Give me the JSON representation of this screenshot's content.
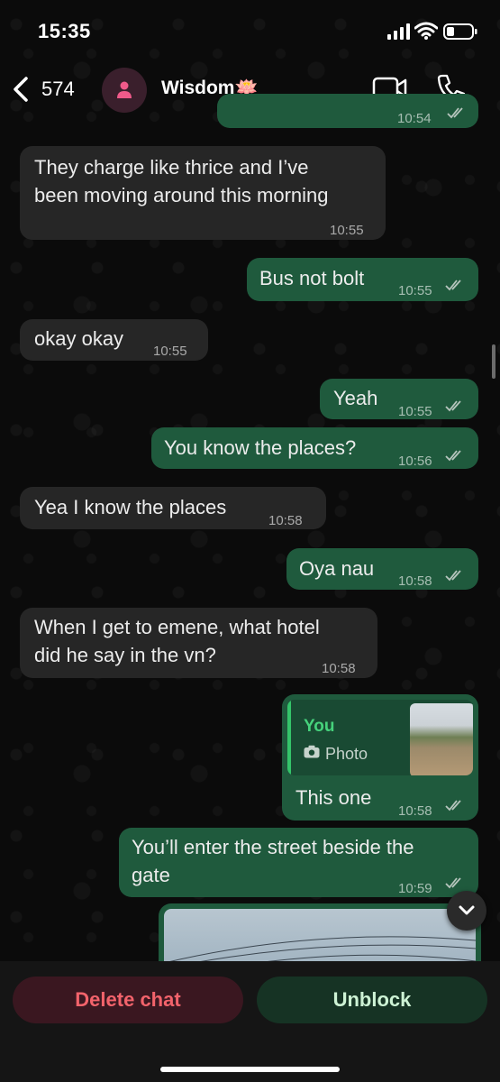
{
  "status_bar": {
    "time": "15:35"
  },
  "header": {
    "back_count": "574",
    "contact_name": "Wisdom🪷"
  },
  "messages": [
    {
      "dir": "out",
      "text": "",
      "time": "10:54",
      "ticks": true
    },
    {
      "dir": "in",
      "lines": [
        "They charge like thrice and I’ve",
        "been moving around this morning"
      ],
      "time": "10:55"
    },
    {
      "dir": "out",
      "text": "Bus not bolt",
      "time": "10:55",
      "ticks": true
    },
    {
      "dir": "in",
      "text": "okay okay",
      "time": "10:55"
    },
    {
      "dir": "out",
      "text": "Yeah",
      "time": "10:55",
      "ticks": true
    },
    {
      "dir": "out",
      "text": "You know the places?",
      "time": "10:56",
      "ticks": true
    },
    {
      "dir": "in",
      "text": "Yea I know the places",
      "time": "10:58"
    },
    {
      "dir": "out",
      "text": "Oya nau",
      "time": "10:58",
      "ticks": true
    },
    {
      "dir": "in",
      "lines": [
        "When I get to emene, what hotel",
        "did he say in the vn?"
      ],
      "time": "10:58"
    },
    {
      "dir": "out",
      "reply": {
        "sender": "You",
        "type": "Photo"
      },
      "text": "This one",
      "time": "10:58",
      "ticks": true
    },
    {
      "dir": "out",
      "lines": [
        "You’ll enter the street beside the",
        "gate"
      ],
      "time": "10:59",
      "ticks": true
    },
    {
      "dir": "out",
      "type": "photo"
    }
  ],
  "actions": {
    "delete_label": "Delete chat",
    "unblock_label": "Unblock"
  },
  "colors": {
    "incoming_bubble": "#262626",
    "outgoing_bubble": "#1f5a3d",
    "delete_text": "#f2636b",
    "unblock_text": "#cdf2d4",
    "reply_accent": "#34c46a"
  }
}
